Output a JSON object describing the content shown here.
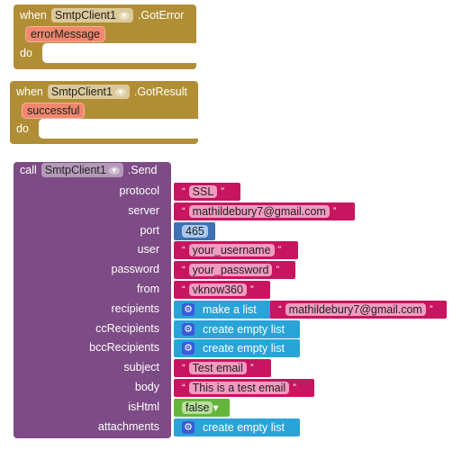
{
  "got_error": {
    "when": "when",
    "component": "SmtpClient1",
    "event": ".GotError",
    "param": "errorMessage",
    "do": "do"
  },
  "got_result": {
    "when": "when",
    "component": "SmtpClient1",
    "event": ".GotResult",
    "param": "successful",
    "do": "do"
  },
  "send": {
    "call": "call",
    "component": "SmtpClient1",
    "method": ".Send",
    "args": [
      {
        "label": "protocol",
        "type": "text",
        "value": "SSL"
      },
      {
        "label": "server",
        "type": "text",
        "value": "mathildebury7@gmail.com"
      },
      {
        "label": "port",
        "type": "number",
        "value": "465"
      },
      {
        "label": "user",
        "type": "text",
        "value": "your_username"
      },
      {
        "label": "password",
        "type": "text",
        "value": "your_password"
      },
      {
        "label": "from",
        "type": "text",
        "value": "vknow360"
      },
      {
        "label": "recipients",
        "type": "make-list",
        "value": "make a list",
        "item": "mathildebury7@gmail.com"
      },
      {
        "label": "ccRecipients",
        "type": "list",
        "value": "create empty list"
      },
      {
        "label": "bccRecipients",
        "type": "list",
        "value": "create empty list"
      },
      {
        "label": "subject",
        "type": "text",
        "value": "Test email"
      },
      {
        "label": "body",
        "type": "text",
        "value": "This is a test email"
      },
      {
        "label": "isHtml",
        "type": "boolean",
        "value": "false"
      },
      {
        "label": "attachments",
        "type": "list",
        "value": "create empty list"
      }
    ]
  },
  "colors": {
    "event": "#b18e35",
    "call": "#7d4b85",
    "text": "#c8155f",
    "math": "#3f71b5",
    "list": "#2aa3d8",
    "logic": "#64b53b"
  }
}
